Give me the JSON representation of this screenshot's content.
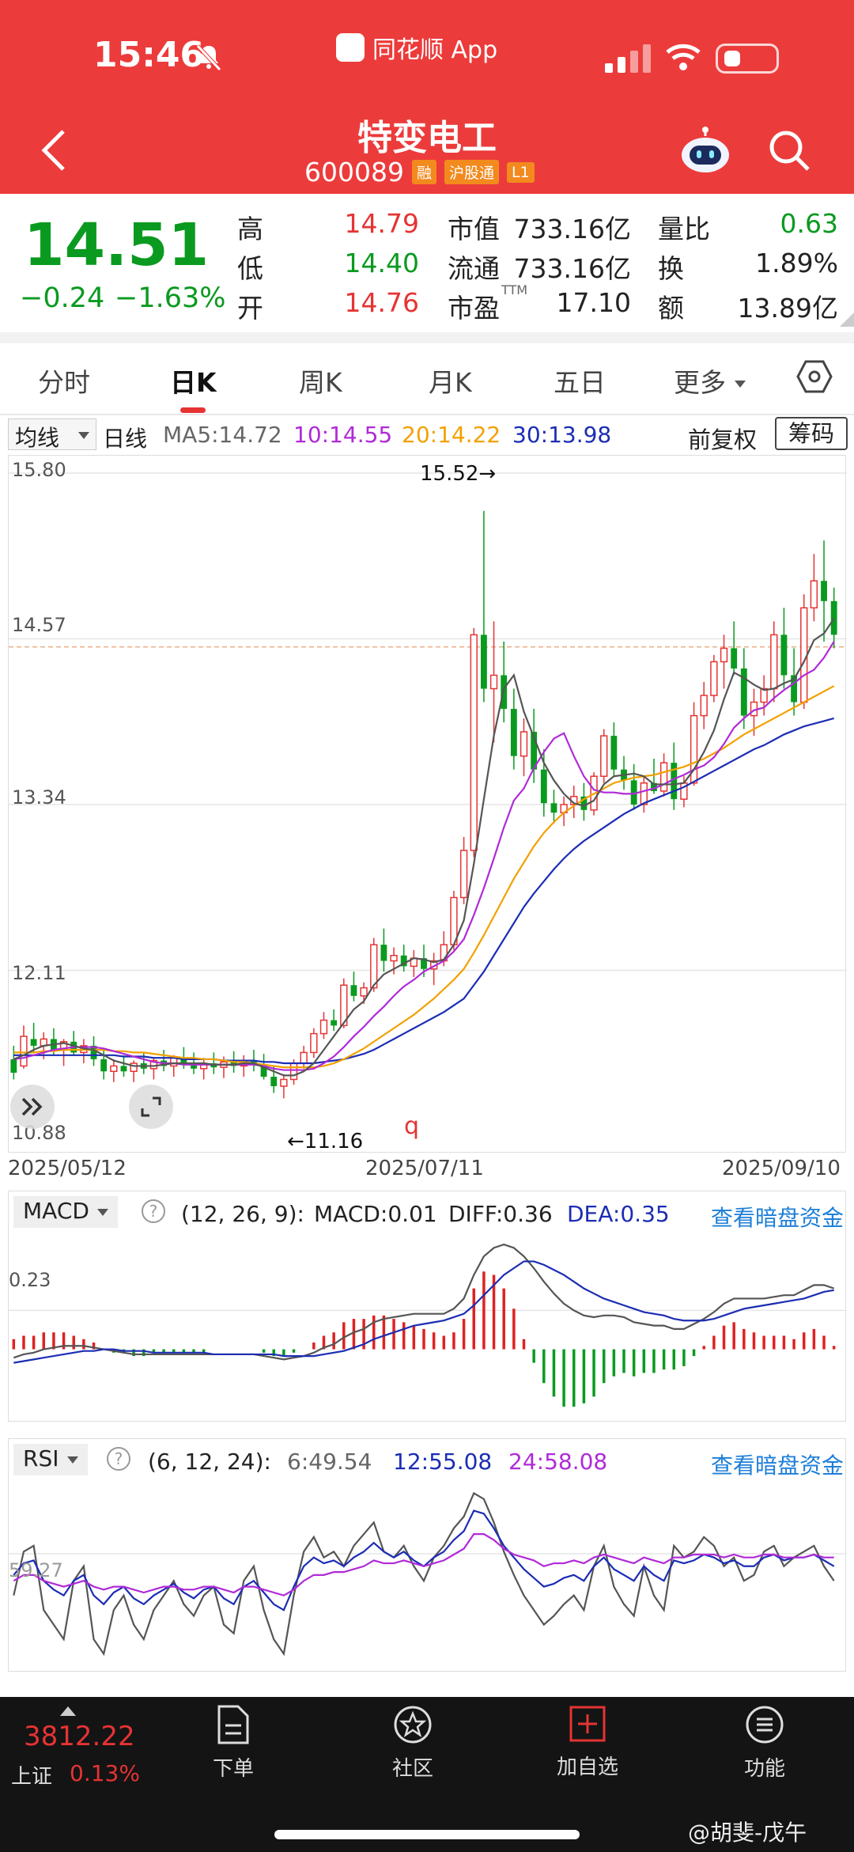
{
  "status_bar": {
    "time": "15:46",
    "app_label": "同花顺 App"
  },
  "header": {
    "name": "特变电工",
    "code": "600089",
    "tags": [
      "融",
      "沪股通",
      "L1"
    ]
  },
  "quote": {
    "price": "14.51",
    "change": "−0.24",
    "change_pct": "−1.63%",
    "high_label": "高",
    "high": "14.79",
    "low_label": "低",
    "low": "14.40",
    "open_label": "开",
    "open": "14.76",
    "mcap_label": "市值",
    "mcap": "733.16亿",
    "float_label": "流通",
    "float": "733.16亿",
    "pe_label": "市盈",
    "pe_sup": "TTM",
    "pe": "17.10",
    "vr_label": "量比",
    "vr": "0.63",
    "turnover_label": "换",
    "turnover": "1.89%",
    "amount_label": "额",
    "amount": "13.89亿"
  },
  "tabs": [
    "分时",
    "日K",
    "周K",
    "月K",
    "五日",
    "更多"
  ],
  "ma_row": {
    "select": "均线",
    "period": "日线",
    "ma5": "MA5:14.72",
    "ma10": "10:14.55",
    "ma20": "20:14.22",
    "ma30": "30:13.98",
    "adj": "前复权",
    "chips": "筹码"
  },
  "kline": {
    "y_labels": [
      "15.80",
      "14.57",
      "13.34",
      "12.11",
      "10.88"
    ],
    "dates": [
      "2025/05/12",
      "2025/07/11",
      "2025/09/10"
    ],
    "max_label": "15.52→",
    "min_label": "←11.16",
    "marker": "q"
  },
  "macd": {
    "select": "MACD",
    "params": "(12, 26, 9):",
    "macd": "MACD:0.01",
    "diff": "DIFF:0.36",
    "dea": "DEA:0.35",
    "link": "查看暗盘资金",
    "y_label": "0.23"
  },
  "rsi": {
    "select": "RSI",
    "params": "(6, 12, 24):",
    "r6": "6:49.54",
    "r12": "12:55.08",
    "r24": "24:58.08",
    "link": "查看暗盘资金",
    "y_label": "59.27"
  },
  "bottom": {
    "index_value": "3812.22",
    "index_name": "上证",
    "index_pct": "0.13%",
    "nav": [
      "下单",
      "社区",
      "加自选",
      "功能"
    ],
    "watermark": "@胡斐-戊午"
  },
  "colors": {
    "up": "#e63333",
    "down": "#0a9a1f",
    "header": "#ec3b3b"
  },
  "chart_data": {
    "type": "candlestick",
    "ylim": [
      10.88,
      15.8
    ],
    "x_start": "2025/05/12",
    "x_end": "2025/09/10",
    "candles": [
      [
        11.45,
        11.55,
        11.3,
        11.35
      ],
      [
        11.4,
        11.7,
        11.38,
        11.62
      ],
      [
        11.6,
        11.72,
        11.5,
        11.55
      ],
      [
        11.55,
        11.65,
        11.45,
        11.6
      ],
      [
        11.6,
        11.68,
        11.48,
        11.52
      ],
      [
        11.52,
        11.6,
        11.4,
        11.58
      ],
      [
        11.58,
        11.66,
        11.48,
        11.5
      ],
      [
        11.5,
        11.6,
        11.42,
        11.55
      ],
      [
        11.55,
        11.62,
        11.4,
        11.45
      ],
      [
        11.45,
        11.52,
        11.3,
        11.36
      ],
      [
        11.36,
        11.45,
        11.28,
        11.4
      ],
      [
        11.4,
        11.48,
        11.32,
        11.36
      ],
      [
        11.36,
        11.44,
        11.28,
        11.42
      ],
      [
        11.42,
        11.5,
        11.34,
        11.38
      ],
      [
        11.38,
        11.46,
        11.3,
        11.44
      ],
      [
        11.44,
        11.52,
        11.36,
        11.4
      ],
      [
        11.4,
        11.48,
        11.32,
        11.46
      ],
      [
        11.46,
        11.54,
        11.38,
        11.42
      ],
      [
        11.42,
        11.5,
        11.34,
        11.38
      ],
      [
        11.38,
        11.46,
        11.3,
        11.42
      ],
      [
        11.42,
        11.5,
        11.34,
        11.39
      ],
      [
        11.39,
        11.47,
        11.31,
        11.43
      ],
      [
        11.43,
        11.51,
        11.35,
        11.4
      ],
      [
        11.4,
        11.48,
        11.32,
        11.44
      ],
      [
        11.44,
        11.52,
        11.36,
        11.41
      ],
      [
        11.41,
        11.49,
        11.3,
        11.32
      ],
      [
        11.32,
        11.4,
        11.2,
        11.25
      ],
      [
        11.25,
        11.34,
        11.16,
        11.3
      ],
      [
        11.3,
        11.45,
        11.26,
        11.42
      ],
      [
        11.42,
        11.55,
        11.38,
        11.5
      ],
      [
        11.5,
        11.68,
        11.46,
        11.64
      ],
      [
        11.64,
        11.8,
        11.6,
        11.74
      ],
      [
        11.74,
        11.82,
        11.66,
        11.7
      ],
      [
        11.7,
        12.05,
        11.68,
        12.0
      ],
      [
        12.0,
        12.1,
        11.88,
        11.92
      ],
      [
        11.92,
        12.02,
        11.86,
        11.98
      ],
      [
        11.98,
        12.35,
        11.95,
        12.3
      ],
      [
        12.3,
        12.42,
        12.1,
        12.18
      ],
      [
        12.18,
        12.28,
        12.08,
        12.22
      ],
      [
        12.22,
        12.3,
        12.1,
        12.14
      ],
      [
        12.14,
        12.26,
        12.06,
        12.2
      ],
      [
        12.2,
        12.3,
        12.06,
        12.12
      ],
      [
        12.12,
        12.24,
        12.0,
        12.18
      ],
      [
        12.18,
        12.4,
        12.14,
        12.3
      ],
      [
        12.3,
        12.7,
        12.26,
        12.65
      ],
      [
        12.65,
        13.1,
        12.6,
        13.0
      ],
      [
        13.0,
        14.65,
        12.95,
        14.6
      ],
      [
        14.6,
        15.52,
        14.1,
        14.2
      ],
      [
        14.2,
        14.7,
        13.8,
        14.3
      ],
      [
        14.3,
        14.55,
        13.95,
        14.05
      ],
      [
        14.05,
        14.2,
        13.6,
        13.7
      ],
      [
        13.7,
        13.98,
        13.55,
        13.88
      ],
      [
        13.88,
        14.05,
        13.5,
        13.6
      ],
      [
        13.6,
        13.75,
        13.25,
        13.35
      ],
      [
        13.35,
        13.45,
        13.2,
        13.28
      ],
      [
        13.28,
        13.4,
        13.18,
        13.34
      ],
      [
        13.34,
        13.48,
        13.24,
        13.4
      ],
      [
        13.4,
        13.5,
        13.22,
        13.3
      ],
      [
        13.3,
        13.58,
        13.26,
        13.55
      ],
      [
        13.55,
        13.9,
        13.5,
        13.85
      ],
      [
        13.85,
        13.95,
        13.55,
        13.6
      ],
      [
        13.6,
        13.7,
        13.45,
        13.52
      ],
      [
        13.52,
        13.64,
        13.3,
        13.34
      ],
      [
        13.34,
        13.55,
        13.28,
        13.5
      ],
      [
        13.5,
        13.68,
        13.42,
        13.44
      ],
      [
        13.44,
        13.72,
        13.4,
        13.65
      ],
      [
        13.65,
        13.8,
        13.3,
        13.38
      ],
      [
        13.38,
        13.55,
        13.32,
        13.5
      ],
      [
        13.5,
        14.1,
        13.48,
        14.0
      ],
      [
        14.0,
        14.25,
        13.9,
        14.15
      ],
      [
        14.15,
        14.45,
        14.1,
        14.4
      ],
      [
        14.4,
        14.6,
        14.2,
        14.5
      ],
      [
        14.5,
        14.7,
        14.3,
        14.35
      ],
      [
        14.35,
        14.5,
        13.9,
        14.0
      ],
      [
        14.0,
        14.2,
        13.85,
        14.1
      ],
      [
        14.1,
        14.3,
        14.0,
        14.2
      ],
      [
        14.2,
        14.7,
        14.1,
        14.6
      ],
      [
        14.6,
        14.8,
        14.2,
        14.3
      ],
      [
        14.3,
        14.5,
        14.0,
        14.1
      ],
      [
        14.1,
        14.9,
        14.05,
        14.8
      ],
      [
        14.8,
        15.2,
        14.7,
        15.0
      ],
      [
        15.0,
        15.3,
        14.55,
        14.85
      ],
      [
        14.85,
        14.95,
        14.5,
        14.6
      ]
    ],
    "ma5": [
      11.45,
      11.48,
      11.52,
      11.55,
      11.56,
      11.57,
      11.55,
      11.53,
      11.52,
      11.48,
      11.44,
      11.42,
      11.4,
      11.4,
      11.4,
      11.41,
      11.42,
      11.42,
      11.42,
      11.42,
      11.41,
      11.41,
      11.41,
      11.42,
      11.42,
      11.39,
      11.36,
      11.33,
      11.33,
      11.36,
      11.42,
      11.52,
      11.62,
      11.72,
      11.82,
      11.88,
      12.0,
      12.08,
      12.12,
      12.16,
      12.2,
      12.19,
      12.17,
      12.19,
      12.3,
      12.48,
      12.9,
      13.38,
      13.85,
      14.2,
      14.3,
      14.03,
      13.84,
      13.65,
      13.52,
      13.42,
      13.35,
      13.33,
      13.37,
      13.49,
      13.55,
      13.56,
      13.57,
      13.55,
      13.49,
      13.49,
      13.49,
      13.5,
      13.6,
      13.73,
      13.89,
      14.12,
      14.32,
      14.28,
      14.23,
      14.19,
      14.2,
      14.24,
      14.27,
      14.4,
      14.56,
      14.61,
      14.72
    ],
    "ma10": [
      11.45,
      11.46,
      11.48,
      11.5,
      11.52,
      11.53,
      11.54,
      11.54,
      11.54,
      11.53,
      11.51,
      11.49,
      11.47,
      11.45,
      11.43,
      11.42,
      11.42,
      11.41,
      11.41,
      11.41,
      11.41,
      11.41,
      11.41,
      11.41,
      11.41,
      11.4,
      11.38,
      11.37,
      11.37,
      11.37,
      11.38,
      11.42,
      11.47,
      11.54,
      11.62,
      11.69,
      11.77,
      11.84,
      11.92,
      11.99,
      12.04,
      12.1,
      12.14,
      12.18,
      12.25,
      12.34,
      12.52,
      12.72,
      12.94,
      13.17,
      13.37,
      13.46,
      13.61,
      13.73,
      13.83,
      13.87,
      13.7,
      13.55,
      13.45,
      13.43,
      13.43,
      13.42,
      13.42,
      13.44,
      13.46,
      13.49,
      13.53,
      13.56,
      13.6,
      13.63,
      13.69,
      13.79,
      13.91,
      13.98,
      14.04,
      14.06,
      14.13,
      14.19,
      14.24,
      14.3,
      14.34,
      14.43,
      14.55
    ],
    "ma20": [
      11.5,
      11.5,
      11.5,
      11.51,
      11.51,
      11.52,
      11.52,
      11.52,
      11.52,
      11.52,
      11.51,
      11.51,
      11.5,
      11.5,
      11.49,
      11.48,
      11.47,
      11.46,
      11.46,
      11.45,
      11.45,
      11.44,
      11.43,
      11.43,
      11.42,
      11.41,
      11.4,
      11.39,
      11.39,
      11.39,
      11.39,
      11.4,
      11.42,
      11.45,
      11.49,
      11.53,
      11.58,
      11.63,
      11.68,
      11.73,
      11.78,
      11.84,
      11.9,
      11.97,
      12.04,
      12.12,
      12.24,
      12.37,
      12.51,
      12.65,
      12.79,
      12.91,
      13.03,
      13.13,
      13.21,
      13.28,
      13.33,
      13.38,
      13.42,
      13.46,
      13.5,
      13.52,
      13.54,
      13.55,
      13.56,
      13.58,
      13.6,
      13.62,
      13.65,
      13.68,
      13.72,
      13.76,
      13.81,
      13.86,
      13.9,
      13.94,
      13.98,
      14.02,
      14.06,
      14.1,
      14.14,
      14.18,
      14.22
    ],
    "ma30": [
      11.48,
      11.48,
      11.48,
      11.48,
      11.48,
      11.48,
      11.48,
      11.48,
      11.48,
      11.48,
      11.48,
      11.47,
      11.47,
      11.47,
      11.46,
      11.46,
      11.46,
      11.45,
      11.45,
      11.45,
      11.45,
      11.44,
      11.44,
      11.44,
      11.44,
      11.43,
      11.43,
      11.42,
      11.42,
      11.42,
      11.42,
      11.43,
      11.44,
      11.45,
      11.47,
      11.49,
      11.52,
      11.56,
      11.6,
      11.64,
      11.68,
      11.72,
      11.76,
      11.8,
      11.85,
      11.9,
      12.0,
      12.1,
      12.22,
      12.34,
      12.46,
      12.58,
      12.68,
      12.77,
      12.86,
      12.94,
      13.01,
      13.07,
      13.12,
      13.17,
      13.22,
      13.27,
      13.31,
      13.35,
      13.38,
      13.41,
      13.44,
      13.47,
      13.51,
      13.55,
      13.59,
      13.63,
      13.67,
      13.71,
      13.75,
      13.78,
      13.82,
      13.86,
      13.89,
      13.92,
      13.94,
      13.96,
      13.98
    ],
    "macd_dif": [
      -0.05,
      -0.03,
      -0.02,
      0.0,
      0.01,
      0.02,
      0.02,
      0.02,
      0.01,
      0.0,
      -0.01,
      -0.02,
      -0.03,
      -0.03,
      -0.03,
      -0.03,
      -0.03,
      -0.03,
      -0.03,
      -0.03,
      -0.03,
      -0.03,
      -0.03,
      -0.03,
      -0.03,
      -0.04,
      -0.05,
      -0.06,
      -0.05,
      -0.04,
      -0.02,
      0.01,
      0.03,
      0.07,
      0.1,
      0.12,
      0.16,
      0.18,
      0.19,
      0.2,
      0.21,
      0.21,
      0.21,
      0.21,
      0.24,
      0.3,
      0.44,
      0.55,
      0.6,
      0.62,
      0.6,
      0.55,
      0.48,
      0.4,
      0.33,
      0.27,
      0.23,
      0.2,
      0.19,
      0.2,
      0.2,
      0.19,
      0.16,
      0.15,
      0.14,
      0.14,
      0.12,
      0.12,
      0.15,
      0.18,
      0.22,
      0.27,
      0.3,
      0.3,
      0.3,
      0.3,
      0.31,
      0.32,
      0.32,
      0.35,
      0.38,
      0.38,
      0.36
    ],
    "macd_dea": [
      -0.08,
      -0.07,
      -0.06,
      -0.05,
      -0.04,
      -0.03,
      -0.02,
      -0.01,
      -0.01,
      0.0,
      0.0,
      -0.01,
      -0.01,
      -0.01,
      -0.02,
      -0.02,
      -0.02,
      -0.02,
      -0.02,
      -0.02,
      -0.03,
      -0.03,
      -0.03,
      -0.03,
      -0.03,
      -0.03,
      -0.03,
      -0.04,
      -0.04,
      -0.04,
      -0.04,
      -0.03,
      -0.02,
      -0.01,
      0.01,
      0.03,
      0.06,
      0.08,
      0.1,
      0.12,
      0.14,
      0.15,
      0.16,
      0.17,
      0.19,
      0.21,
      0.26,
      0.32,
      0.38,
      0.44,
      0.48,
      0.52,
      0.52,
      0.5,
      0.47,
      0.44,
      0.4,
      0.36,
      0.33,
      0.3,
      0.28,
      0.26,
      0.24,
      0.22,
      0.21,
      0.2,
      0.18,
      0.17,
      0.17,
      0.17,
      0.18,
      0.2,
      0.22,
      0.24,
      0.25,
      0.26,
      0.27,
      0.28,
      0.29,
      0.3,
      0.32,
      0.34,
      0.35
    ],
    "rsi6": [
      45,
      60,
      62,
      40,
      35,
      30,
      50,
      55,
      30,
      25,
      40,
      45,
      35,
      30,
      40,
      45,
      50,
      42,
      38,
      45,
      48,
      35,
      32,
      50,
      55,
      40,
      30,
      25,
      45,
      60,
      65,
      58,
      60,
      55,
      62,
      66,
      70,
      60,
      58,
      62,
      55,
      50,
      58,
      62,
      68,
      72,
      80,
      78,
      70,
      60,
      52,
      45,
      40,
      35,
      38,
      42,
      45,
      40,
      55,
      62,
      48,
      42,
      38,
      55,
      45,
      40,
      62,
      58,
      60,
      65,
      62,
      55,
      58,
      50,
      52,
      60,
      62,
      55,
      58,
      60,
      62,
      55,
      50
    ],
    "rsi12": [
      52,
      56,
      57,
      50,
      47,
      45,
      50,
      52,
      45,
      42,
      46,
      48,
      44,
      42,
      45,
      47,
      49,
      46,
      44,
      47,
      48,
      44,
      42,
      48,
      50,
      46,
      42,
      40,
      48,
      55,
      58,
      56,
      57,
      55,
      58,
      60,
      63,
      60,
      58,
      60,
      57,
      55,
      58,
      60,
      64,
      67,
      74,
      73,
      68,
      62,
      58,
      54,
      51,
      48,
      49,
      51,
      52,
      50,
      55,
      58,
      54,
      52,
      50,
      55,
      52,
      50,
      57,
      56,
      57,
      59,
      58,
      56,
      57,
      55,
      55,
      58,
      59,
      57,
      58,
      58,
      59,
      57,
      55
    ],
    "rsi24": [
      50,
      52,
      52,
      50,
      49,
      48,
      49,
      50,
      48,
      47,
      48,
      48,
      47,
      46,
      47,
      48,
      48,
      47,
      47,
      48,
      48,
      47,
      46,
      48,
      48,
      47,
      46,
      45,
      47,
      50,
      52,
      52,
      53,
      53,
      54,
      55,
      57,
      56,
      56,
      57,
      56,
      55,
      56,
      57,
      59,
      61,
      66,
      66,
      64,
      61,
      59,
      58,
      57,
      55,
      56,
      56,
      57,
      56,
      58,
      59,
      58,
      57,
      56,
      58,
      57,
      56,
      58,
      58,
      59,
      59,
      59,
      58,
      59,
      58,
      58,
      59,
      59,
      58,
      58,
      58,
      59,
      58,
      58
    ]
  }
}
